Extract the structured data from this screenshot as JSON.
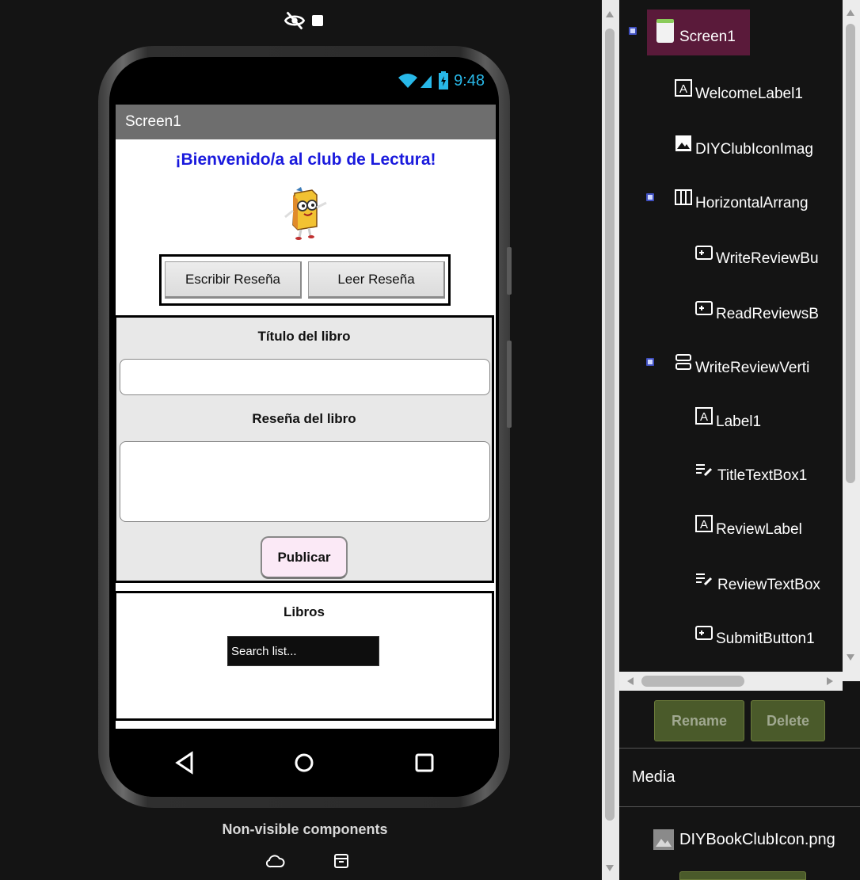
{
  "phone": {
    "time": "9:48",
    "screen_title": "Screen1",
    "welcome_text": "¡Bienvenido/a al club de Lectura!",
    "write_review_button": "Escribir Reseña",
    "read_review_button": "Leer Reseña",
    "book_title_label": "Título del libro",
    "book_review_label": "Reseña del libro",
    "publish_button": "Publicar",
    "books_label": "Libros",
    "search_placeholder": "Search list..."
  },
  "non_visible_components_label": "Non-visible components",
  "tree": {
    "items": [
      {
        "label": "Screen1",
        "icon": "screen-icon"
      },
      {
        "label": "WelcomeLabel1",
        "icon": "label-icon"
      },
      {
        "label": "DIYClubIconImag",
        "icon": "image-icon"
      },
      {
        "label": "HorizontalArrang",
        "icon": "horizontal-arrangement-icon"
      },
      {
        "label": "WriteReviewBu",
        "icon": "button-icon"
      },
      {
        "label": "ReadReviewsB",
        "icon": "button-icon"
      },
      {
        "label": "WriteReviewVerti",
        "icon": "vertical-arrangement-icon"
      },
      {
        "label": "Label1",
        "icon": "label-icon"
      },
      {
        "label": "TitleTextBox1",
        "icon": "textbox-icon"
      },
      {
        "label": "ReviewLabel",
        "icon": "label-icon"
      },
      {
        "label": "ReviewTextBox",
        "icon": "textbox-icon"
      },
      {
        "label": "SubmitButton1",
        "icon": "button-icon"
      }
    ]
  },
  "actions": {
    "rename": "Rename",
    "delete": "Delete"
  },
  "media": {
    "heading": "Media",
    "file": "DIYBookClubIcon.png"
  },
  "colors": {
    "selected": "#5a1a3a",
    "title_blue": "#1a1add",
    "action_green": "#4a5a2a"
  }
}
